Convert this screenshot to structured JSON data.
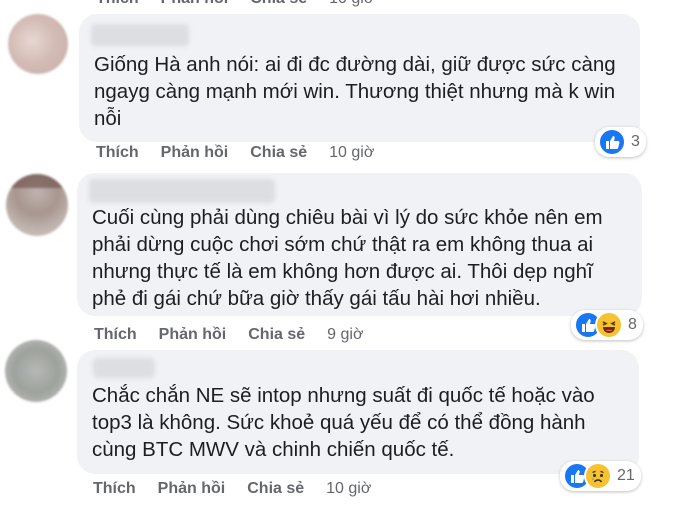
{
  "top_actions": {
    "like": "Thích",
    "reply": "Phản hồi",
    "share": "Chia sẻ",
    "time": "10 giờ"
  },
  "comments": [
    {
      "text": "Giống Hà anh nói: ai đi đc đường dài, giữ được sức càng\nngayg càng mạnh mới win. Thương thiệt nhưng mà k win\nnỗi",
      "reaction_count": "3",
      "reactions": [
        "like-icon"
      ],
      "like": "Thích",
      "reply": "Phản hồi",
      "share": "Chia sẻ",
      "time": "10 giờ"
    },
    {
      "text": "Cuối cùng phải dùng chiêu bài vì lý do sức khỏe nên em\nphải dừng cuộc chơi sớm chứ thật ra em không thua ai\nnhưng thực tế là em không hơn được ai. Thôi dẹp nghĩ\nphẻ đi gái chứ bữa giờ thấy gái tấu hài hơi nhiều.",
      "reaction_count": "8",
      "reactions": [
        "like-icon",
        "haha-icon"
      ],
      "like": "Thích",
      "reply": "Phản hồi",
      "share": "Chia sẻ",
      "time": "9 giờ"
    },
    {
      "text": "Chắc chắn NE sẽ intop nhưng suất đi quốc tế hoặc vào\ntop3 là không. Sức khoẻ quá yếu để có thể đồng hành\ncùng BTC MWV và chinh chiến quốc tế.",
      "reaction_count": "21",
      "reactions": [
        "like-icon",
        "sad-icon"
      ],
      "like": "Thích",
      "reply": "Phản hồi",
      "share": "Chia sẻ",
      "time": "10 giờ"
    }
  ],
  "colors": {
    "like_blue": "#1877f2",
    "emoji_yellow": "#f7c22f",
    "bubble": "#f0f2f5",
    "meta": "#65676b"
  }
}
